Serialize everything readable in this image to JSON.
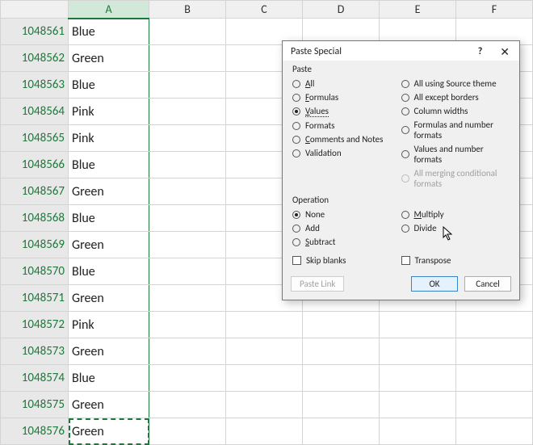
{
  "columns": [
    "A",
    "B",
    "C",
    "D",
    "E",
    "F"
  ],
  "col_widths": {
    "rowhead": 84,
    "A": 100,
    "rest": 95
  },
  "selected_column": "A",
  "active_row": 1048576,
  "rows": [
    {
      "n": 1048561,
      "v": "Blue"
    },
    {
      "n": 1048562,
      "v": "Green"
    },
    {
      "n": 1048563,
      "v": "Blue"
    },
    {
      "n": 1048564,
      "v": "Pink"
    },
    {
      "n": 1048565,
      "v": "Pink"
    },
    {
      "n": 1048566,
      "v": "Blue"
    },
    {
      "n": 1048567,
      "v": "Green"
    },
    {
      "n": 1048568,
      "v": "Blue"
    },
    {
      "n": 1048569,
      "v": "Green"
    },
    {
      "n": 1048570,
      "v": "Blue"
    },
    {
      "n": 1048571,
      "v": "Green"
    },
    {
      "n": 1048572,
      "v": "Pink"
    },
    {
      "n": 1048573,
      "v": "Green"
    },
    {
      "n": 1048574,
      "v": "Blue"
    },
    {
      "n": 1048575,
      "v": "Green"
    },
    {
      "n": 1048576,
      "v": "Green"
    }
  ],
  "dialog": {
    "title": "Paste Special",
    "help": "?",
    "close": "✕",
    "section_paste": "Paste",
    "section_op": "Operation",
    "paste_left": [
      {
        "key": "all",
        "label": "All",
        "u": "A",
        "checked": false
      },
      {
        "key": "formulas",
        "label": "Formulas",
        "u": "F",
        "checked": false
      },
      {
        "key": "values",
        "label": "Values",
        "u": "V",
        "checked": true,
        "dotsel": true
      },
      {
        "key": "formats",
        "label": "Formats",
        "u": "T",
        "checked": false
      },
      {
        "key": "comments",
        "label": "Comments and Notes",
        "u": "C",
        "checked": false
      },
      {
        "key": "validation",
        "label": "Validation",
        "u": "N",
        "checked": false
      }
    ],
    "paste_right": [
      {
        "key": "source_theme",
        "label": "All using Source theme",
        "u": "",
        "checked": false
      },
      {
        "key": "except_borders",
        "label": "All except borders",
        "u": "X",
        "checked": false
      },
      {
        "key": "col_widths",
        "label": "Column widths",
        "u": "W",
        "checked": false
      },
      {
        "key": "formulas_num",
        "label": "Formulas and number formats",
        "u": "R",
        "checked": false
      },
      {
        "key": "values_num",
        "label": "Values and number formats",
        "u": "U",
        "checked": false
      },
      {
        "key": "merge_cond",
        "label": "All merging conditional formats",
        "u": "",
        "checked": false,
        "disabled": true
      }
    ],
    "op_left": [
      {
        "key": "none",
        "label": "None",
        "u": "O",
        "checked": true
      },
      {
        "key": "add",
        "label": "Add",
        "u": "D",
        "checked": false
      },
      {
        "key": "subtract",
        "label": "Subtract",
        "u": "S",
        "checked": false
      }
    ],
    "op_right": [
      {
        "key": "multiply",
        "label": "Multiply",
        "u": "M",
        "checked": false
      },
      {
        "key": "divide",
        "label": "Divide",
        "u": "I",
        "checked": false
      }
    ],
    "skip_blanks": {
      "label": "Skip blanks",
      "u": "B",
      "checked": false
    },
    "transpose": {
      "label": "Transpose",
      "u": "E",
      "checked": false
    },
    "paste_link": "Paste Link",
    "ok": "OK",
    "cancel": "Cancel"
  }
}
